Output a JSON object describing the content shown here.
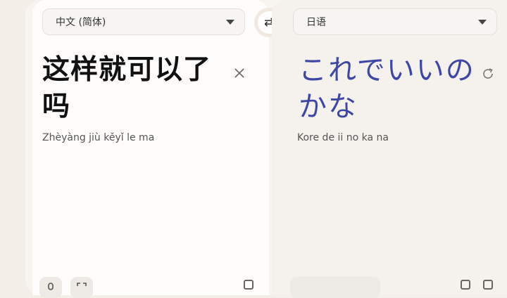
{
  "source": {
    "language": "中文 (简体)",
    "text": "这样就可以了吗",
    "romanization": "Zhèyàng jiù kěyǐ le ma"
  },
  "target": {
    "language": "日语",
    "text": "これでいいのかな",
    "romanization": "Kore de ii no ka na"
  },
  "swap_icon": "⇄",
  "icons": {
    "swap": "swap-arrows-icon",
    "clear": "close-icon",
    "refresh": "refresh-icon",
    "dropdown": "caret-down-icon"
  },
  "colors": {
    "translation_text": "#3e47a6",
    "background": "#f3eee7"
  }
}
